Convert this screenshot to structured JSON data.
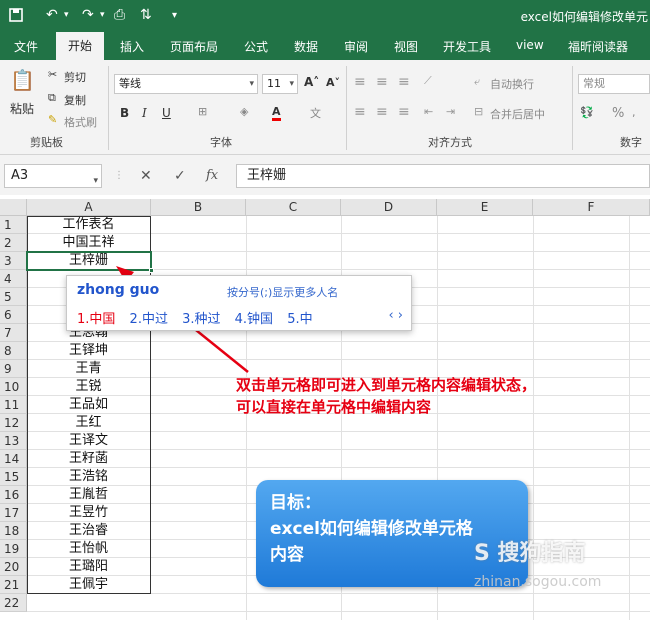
{
  "title_bar": {
    "doc_title": "excel如何编辑修改单元",
    "icons": [
      "save-icon",
      "undo-icon",
      "redo-icon",
      "print-preview-icon",
      "sort-icon",
      "customize-icon"
    ]
  },
  "tabs": [
    "文件",
    "开始",
    "插入",
    "页面布局",
    "公式",
    "数据",
    "审阅",
    "视图",
    "开发工具",
    "view",
    "福昕阅读器"
  ],
  "active_tab": "开始",
  "ribbon": {
    "clipboard": {
      "paste": "粘贴",
      "cut": "剪切",
      "copy": "复制",
      "format_painter": "格式刷",
      "group": "剪贴板"
    },
    "font": {
      "name": "等线",
      "size": "11",
      "bold": "B",
      "italic": "I",
      "underline": "U",
      "group": "字体"
    },
    "alignment": {
      "wrap": "自动换行",
      "merge": "合并后居中",
      "group": "对齐方式"
    },
    "number": {
      "format": "常规",
      "percent": "%",
      "group": "数字"
    }
  },
  "formula_bar": {
    "name_box": "A3",
    "fx": "fx",
    "content": "王梓姗"
  },
  "columns": [
    "A",
    "B",
    "C",
    "D",
    "E",
    "F"
  ],
  "rows": [
    "1",
    "2",
    "3",
    "4",
    "5",
    "6",
    "7",
    "8",
    "9",
    "10",
    "11",
    "12",
    "13",
    "14",
    "15",
    "16",
    "17",
    "18",
    "19",
    "20",
    "21",
    "22"
  ],
  "col_a": [
    "工作表名",
    "中国王祥",
    "王梓姗",
    "",
    "",
    "",
    "王思翰",
    "王铎坤",
    "王青",
    "王锐",
    "王品如",
    "王红",
    "王译文",
    "王籽菡",
    "王浩铭",
    "王胤哲",
    "王昱竹",
    "王治睿",
    "王怡帆",
    "王璐阳",
    "王佩宇",
    ""
  ],
  "ime": {
    "pinyin": "zhong guo",
    "hint": "按分号(;)显示更多人名",
    "candidates": [
      "1.中国",
      "2.中过",
      "3.种过",
      "4.钟国",
      "5.中"
    ],
    "nav": "‹ ›"
  },
  "annotation": {
    "line1": "双击单元格即可进入到单元格内容编辑状态，",
    "line2": "可以直接在单元格中编辑内容"
  },
  "goal_box": {
    "line1": "目标：",
    "line2": "excel如何编辑修改单元格",
    "line3": "内容"
  },
  "watermark": {
    "text": "S 搜狗指南",
    "url": "zhinan.sogou.com"
  },
  "colors": {
    "excel_green": "#217346",
    "annotation_red": "#e60012",
    "goal_blue": "#2b8ae6"
  }
}
